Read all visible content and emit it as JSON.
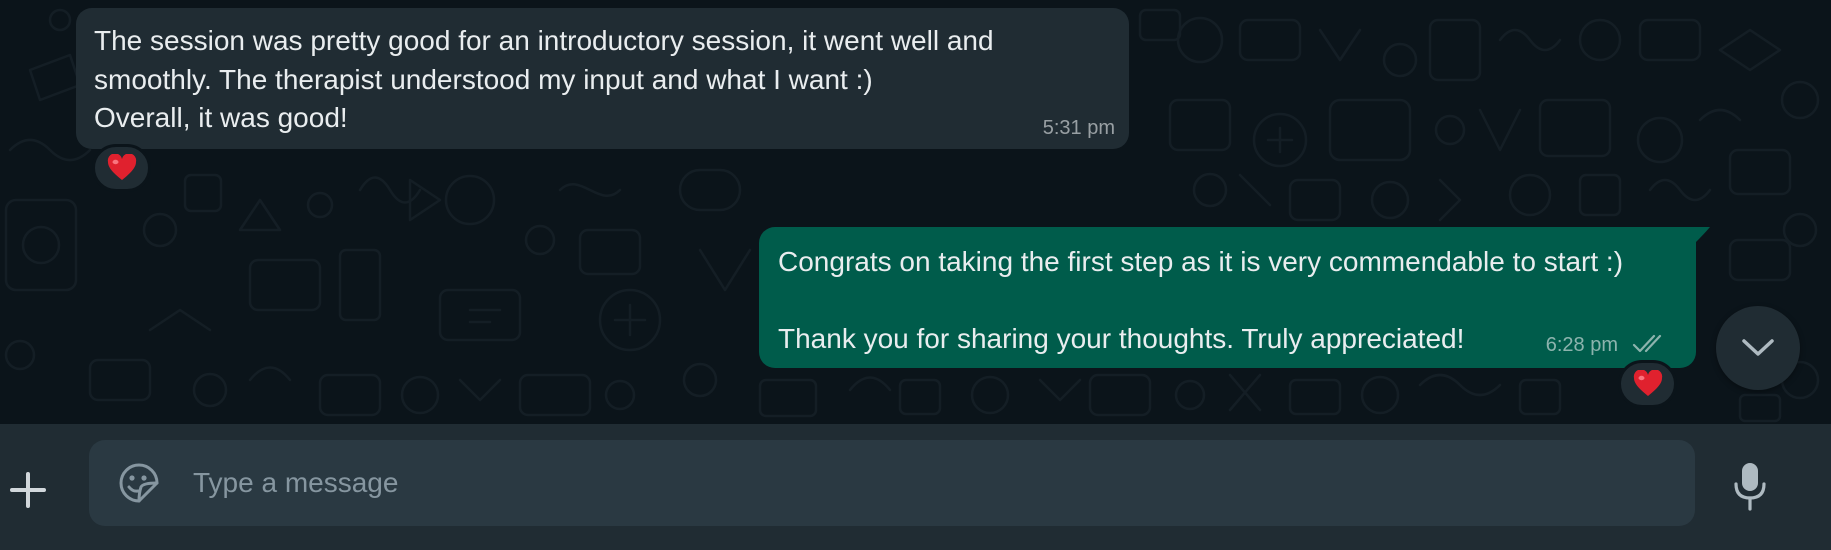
{
  "conversation": {
    "messages": [
      {
        "direction": "incoming",
        "lines": [
          "The session was pretty good for an introductory session, it went well and",
          "smoothly. The therapist understood my input and what I want :)",
          "Overall, it was good!"
        ],
        "time": "5:31 pm",
        "reaction": "red-heart"
      },
      {
        "direction": "outgoing",
        "lines": [
          "Congrats on taking the first step as it is very commendable to start :)",
          "",
          "Thank you for sharing your thoughts. Truly appreciated!"
        ],
        "time": "6:28 pm",
        "status": "read",
        "reaction": "red-heart"
      }
    ],
    "scroll_down_icon": "chevron-down-icon"
  },
  "composer": {
    "placeholder": "Type a message",
    "value": "",
    "attach_icon": "plus-icon",
    "sticker_icon": "sticker-icon",
    "mic_icon": "microphone-icon"
  },
  "colors": {
    "chat_background": "#0b141a",
    "incoming_bubble": "#202c33",
    "outgoing_bubble": "#005c4b",
    "composer_bar": "#202c33",
    "input_field": "#2a3942",
    "heart": "#e0212e"
  }
}
